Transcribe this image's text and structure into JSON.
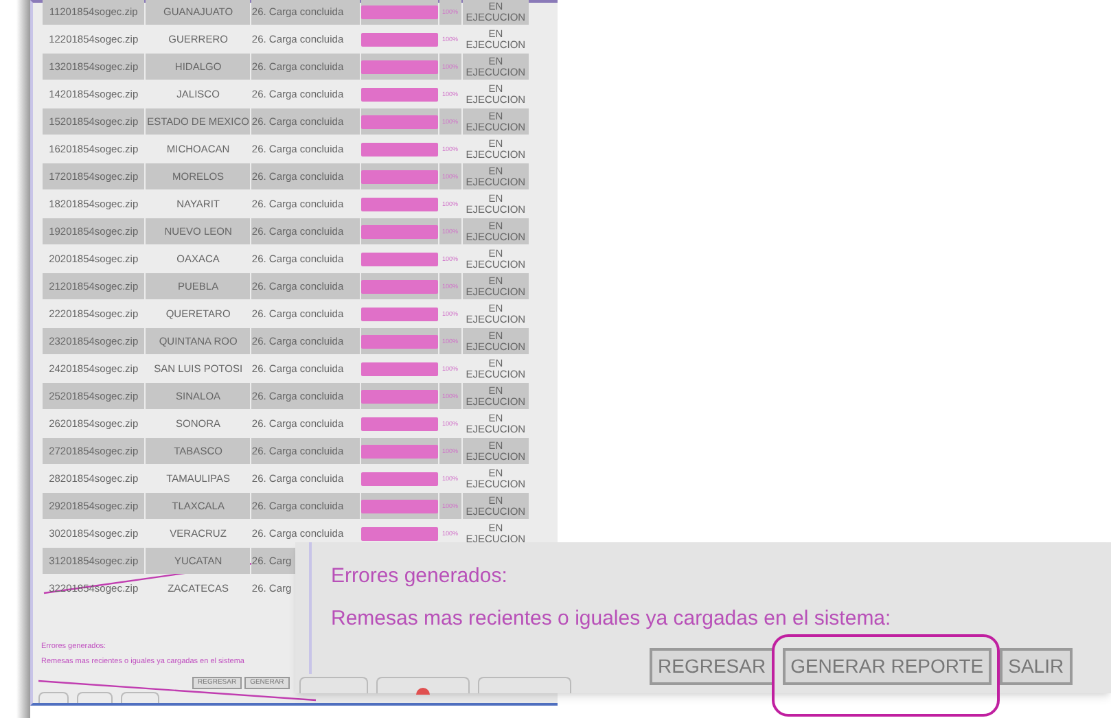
{
  "main_window": {
    "rows": [
      {
        "file": "11201854sogec.zip",
        "state": "GUANAJUATO",
        "status": "26. Carga concluida",
        "level": 1,
        "percent": "100%",
        "execution": "EN EJECUCION"
      },
      {
        "file": "12201854sogec.zip",
        "state": "GUERRERO",
        "status": "26. Carga concluida",
        "level": 1,
        "percent": "100%",
        "execution": "EN EJECUCION"
      },
      {
        "file": "13201854sogec.zip",
        "state": "HIDALGO",
        "status": "26. Carga concluida",
        "level": 1,
        "percent": "100%",
        "execution": "EN EJECUCION"
      },
      {
        "file": "14201854sogec.zip",
        "state": "JALISCO",
        "status": "26. Carga concluida",
        "level": 1,
        "percent": "100%",
        "execution": "EN EJECUCION"
      },
      {
        "file": "15201854sogec.zip",
        "state": "ESTADO DE MEXICO",
        "status": "26. Carga concluida",
        "level": 1,
        "percent": "100%",
        "execution": "EN EJECUCION"
      },
      {
        "file": "16201854sogec.zip",
        "state": "MICHOACAN",
        "status": "26. Carga concluida",
        "level": 1,
        "percent": "100%",
        "execution": "EN EJECUCION"
      },
      {
        "file": "17201854sogec.zip",
        "state": "MORELOS",
        "status": "26. Carga concluida",
        "level": 1,
        "percent": "100%",
        "execution": "EN EJECUCION"
      },
      {
        "file": "18201854sogec.zip",
        "state": "NAYARIT",
        "status": "26. Carga concluida",
        "level": 1,
        "percent": "100%",
        "execution": "EN EJECUCION"
      },
      {
        "file": "19201854sogec.zip",
        "state": "NUEVO LEON",
        "status": "26. Carga concluida",
        "level": 1,
        "percent": "100%",
        "execution": "EN EJECUCION"
      },
      {
        "file": "20201854sogec.zip",
        "state": "OAXACA",
        "status": "26. Carga concluida",
        "level": 1,
        "percent": "100%",
        "execution": "EN EJECUCION"
      },
      {
        "file": "21201854sogec.zip",
        "state": "PUEBLA",
        "status": "26. Carga concluida",
        "level": 1,
        "percent": "100%",
        "execution": "EN EJECUCION"
      },
      {
        "file": "22201854sogec.zip",
        "state": "QUERETARO",
        "status": "26. Carga concluida",
        "level": 1,
        "percent": "100%",
        "execution": "EN EJECUCION"
      },
      {
        "file": "23201854sogec.zip",
        "state": "QUINTANA ROO",
        "status": "26. Carga concluida",
        "level": 1,
        "percent": "100%",
        "execution": "EN EJECUCION"
      },
      {
        "file": "24201854sogec.zip",
        "state": "SAN LUIS POTOSI",
        "status": "26. Carga concluida",
        "level": 1,
        "percent": "100%",
        "execution": "EN EJECUCION"
      },
      {
        "file": "25201854sogec.zip",
        "state": "SINALOA",
        "status": "26. Carga concluida",
        "level": 1,
        "percent": "100%",
        "execution": "EN EJECUCION"
      },
      {
        "file": "26201854sogec.zip",
        "state": "SONORA",
        "status": "26. Carga concluida",
        "level": 1,
        "percent": "100%",
        "execution": "EN EJECUCION"
      },
      {
        "file": "27201854sogec.zip",
        "state": "TABASCO",
        "status": "26. Carga concluida",
        "level": 1,
        "percent": "100%",
        "execution": "EN EJECUCION"
      },
      {
        "file": "28201854sogec.zip",
        "state": "TAMAULIPAS",
        "status": "26. Carga concluida",
        "level": 1,
        "percent": "100%",
        "execution": "EN EJECUCION"
      },
      {
        "file": "29201854sogec.zip",
        "state": "TLAXCALA",
        "status": "26. Carga concluida",
        "level": 1,
        "percent": "100%",
        "execution": "EN EJECUCION"
      },
      {
        "file": "30201854sogec.zip",
        "state": "VERACRUZ",
        "status": "26. Carga concluida",
        "level": 1,
        "percent": "100%",
        "execution": "EN EJECUCION"
      },
      {
        "file": "31201854sogec.zip",
        "state": "YUCATAN",
        "status": "26. Carg"
      },
      {
        "file": "32201854sogec.zip",
        "state": "ZACATECAS",
        "status": "26. Carg"
      }
    ],
    "errors_title": "Errores generados:",
    "errors_message": "Remesas mas recientes o iguales ya cargadas en el sistema",
    "buttons": [
      "REGRESAR",
      "GENERAR"
    ]
  },
  "callout": {
    "errors_title": "Errores generados:",
    "errors_message": "Remesas mas recientes o iguales ya cargadas en el sistema:",
    "buttons": [
      {
        "label": "REGRESAR",
        "highlighted": false
      },
      {
        "label": "GENERAR REPORTE",
        "highlighted": true
      },
      {
        "label": "SALIR",
        "highlighted": false
      }
    ]
  }
}
